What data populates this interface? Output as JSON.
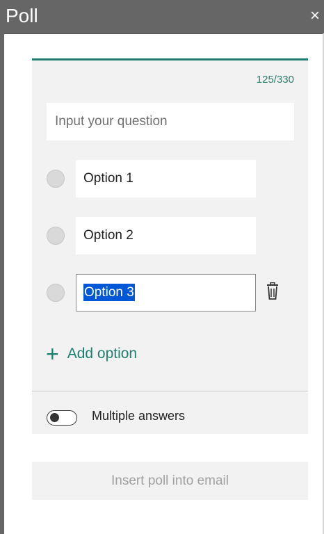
{
  "window": {
    "title": "Poll",
    "close_glyph": "×"
  },
  "poll": {
    "char_counter": "125/330",
    "question_placeholder": "Input your question",
    "options": [
      {
        "label": "Option 1"
      },
      {
        "label": "Option 2"
      },
      {
        "label": "Option 3",
        "selected": true
      }
    ],
    "add_option_label": "Add option",
    "add_option_icon": "plus-icon",
    "delete_icon": "trash-icon",
    "multiple_answers_label": "Multiple answers",
    "multiple_answers_enabled": false
  },
  "footer": {
    "insert_label": "Insert poll into email"
  },
  "colors": {
    "titlebar": "#666666",
    "accent": "#1f7f6f",
    "selection": "#0058d6",
    "card_bg": "#f2f2f2"
  }
}
